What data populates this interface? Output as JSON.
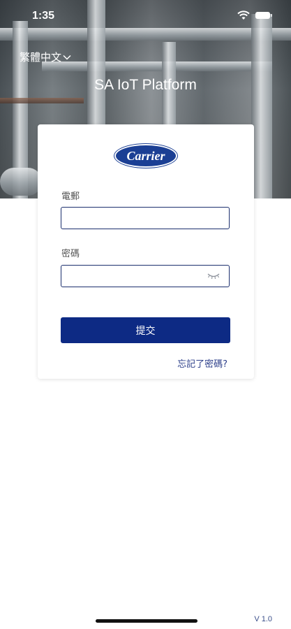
{
  "status_bar": {
    "time": "1:35"
  },
  "header": {
    "language": "繁體中文",
    "app_title": "SA IoT Platform"
  },
  "login": {
    "logo_text": "Carrier",
    "email_label": "電郵",
    "email_value": "",
    "password_label": "密碼",
    "password_value": "",
    "submit_label": "提交",
    "forgot_label": "忘記了密碼?"
  },
  "footer": {
    "version": "V 1.0"
  },
  "icons": [
    "wifi-icon",
    "battery-icon",
    "chevron-down-icon",
    "eye-closed-icon"
  ],
  "colors": {
    "accent": "#0d2a84",
    "link": "#2d3f8a",
    "brand": "#1b3f94"
  }
}
